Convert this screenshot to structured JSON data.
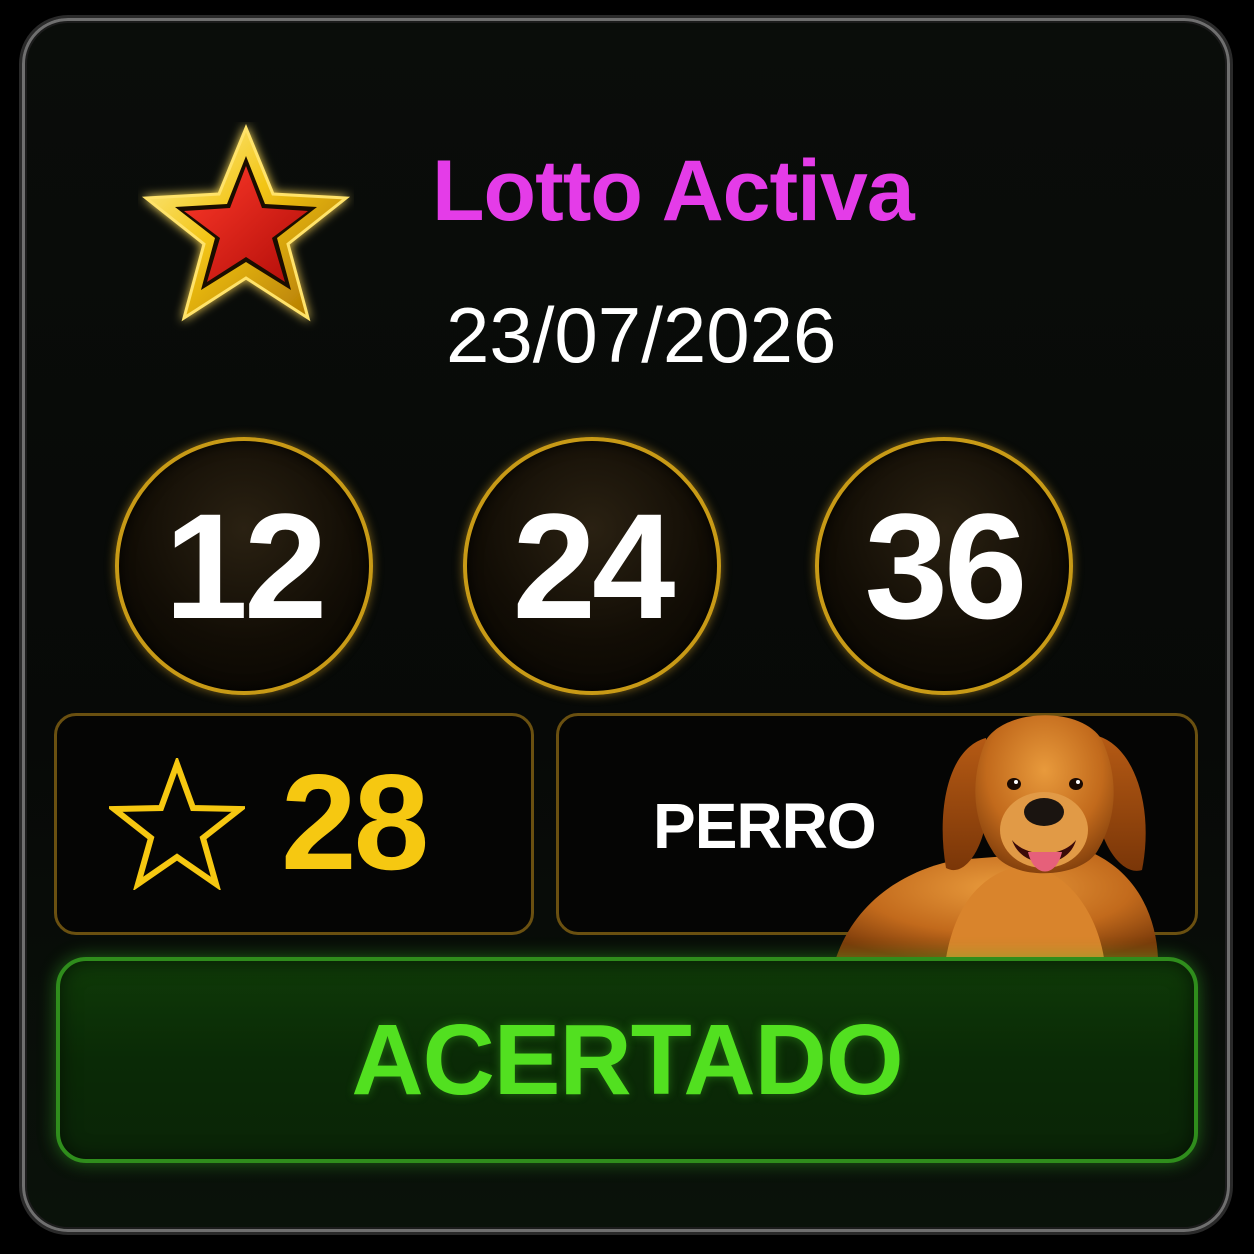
{
  "header": {
    "title": "Lotto Activa",
    "date": "23/07/2026",
    "logo_icon": "red-gold-star-icon"
  },
  "numbers": [
    "12",
    "24",
    "36"
  ],
  "bonus": {
    "icon": "star-outline-icon",
    "value": "28"
  },
  "animal": {
    "name": "PERRO",
    "image": "dog-image"
  },
  "status": {
    "label": "ACERTADO"
  },
  "colors": {
    "title": "#e43ce8",
    "gold": "#c89a16",
    "bonus": "#f6c811",
    "status_text": "#52e020",
    "status_border": "#2f8d1c"
  }
}
